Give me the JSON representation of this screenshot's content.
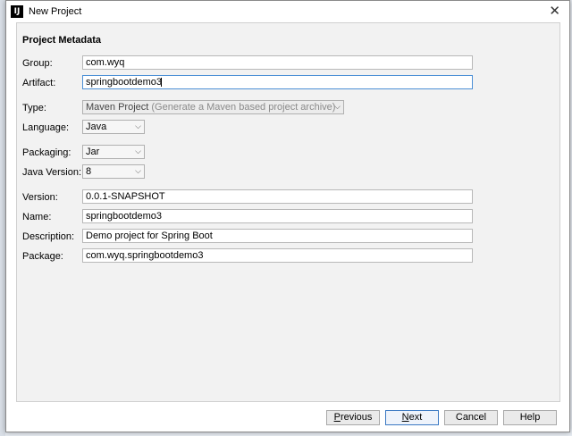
{
  "window": {
    "title": "New Project",
    "app_icon": "IJ"
  },
  "section_title": "Project Metadata",
  "fields": {
    "group": {
      "label": "Group:",
      "value": "com.wyq"
    },
    "artifact": {
      "label": "Artifact:",
      "value": "springbootdemo3"
    },
    "type": {
      "label": "Type:",
      "value": "Maven Project",
      "hint": "(Generate a Maven based project archive)"
    },
    "language": {
      "label": "Language:",
      "value": "Java"
    },
    "packaging": {
      "label": "Packaging:",
      "value": "Jar"
    },
    "java_version": {
      "label": "Java Version:",
      "value": "8"
    },
    "version": {
      "label": "Version:",
      "value": "0.0.1-SNAPSHOT"
    },
    "name": {
      "label": "Name:",
      "value": "springbootdemo3"
    },
    "description": {
      "label": "Description:",
      "value": "Demo project for Spring Boot"
    },
    "package": {
      "label": "Package:",
      "value": "com.wyq.springbootdemo3"
    }
  },
  "buttons": {
    "previous": {
      "mnemonic": "P",
      "rest": "revious"
    },
    "next": {
      "mnemonic": "N",
      "rest": "ext"
    },
    "cancel": "Cancel",
    "help": "Help"
  },
  "icons": {
    "close": "close-icon",
    "chevron": "chevron-down-icon"
  }
}
